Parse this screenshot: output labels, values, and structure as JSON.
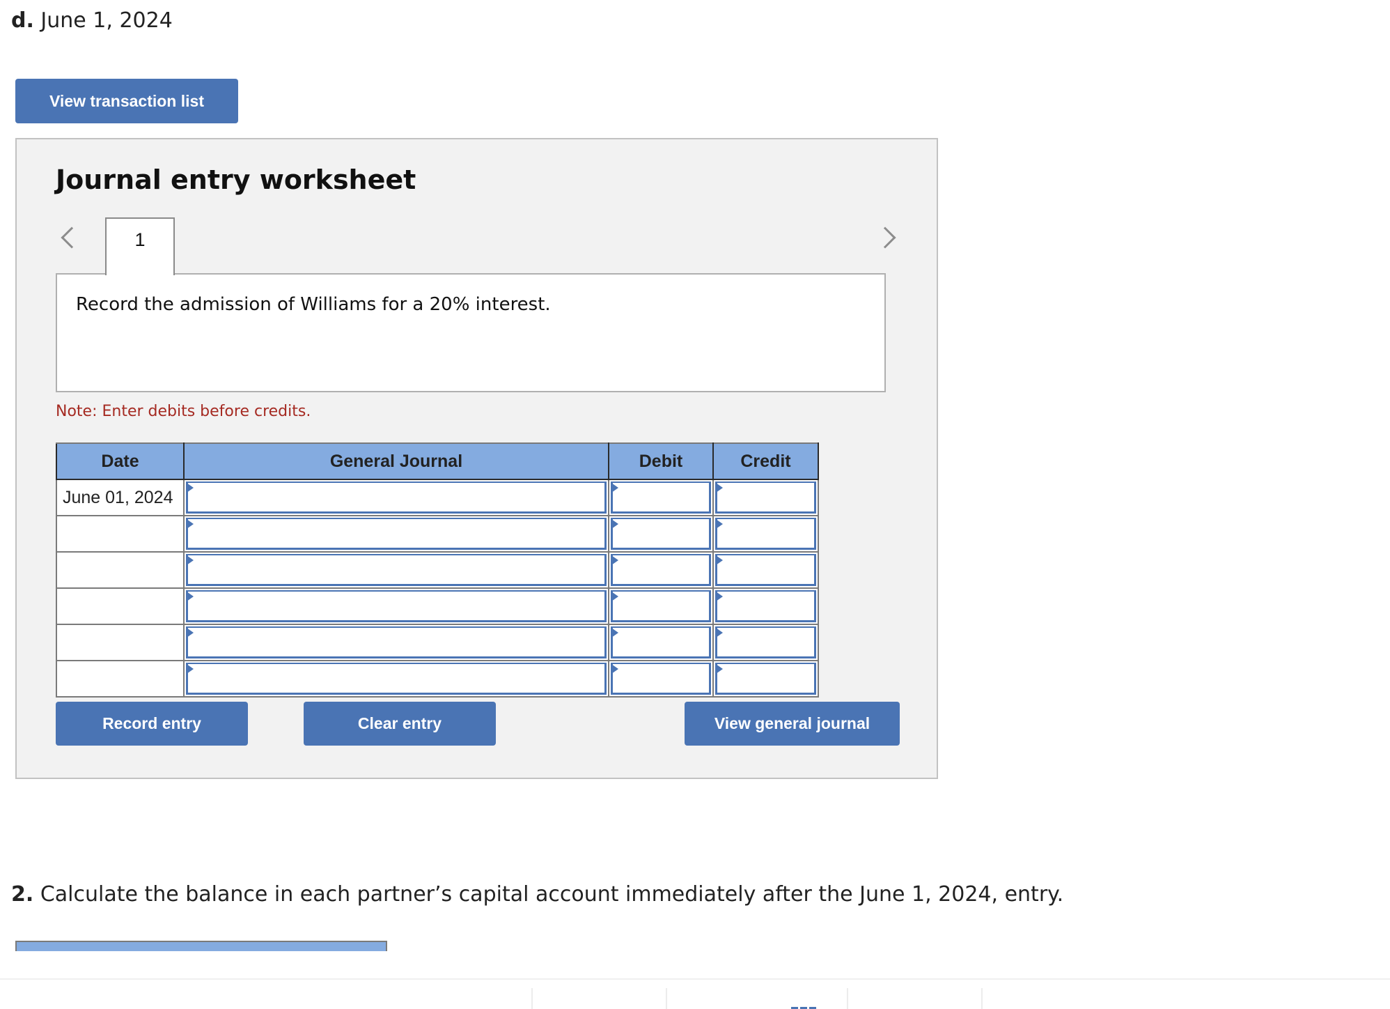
{
  "part": {
    "label": "d.",
    "date": "June 1, 2024"
  },
  "buttons": {
    "view_transaction_list": "View transaction list",
    "record_entry": "Record entry",
    "clear_entry": "Clear entry",
    "view_general_journal": "View general journal"
  },
  "worksheet": {
    "title": "Journal entry worksheet",
    "tabs": [
      {
        "label": "1",
        "active": true
      }
    ],
    "description": "Record the admission of Williams for a 20% interest.",
    "note": "Note: Enter debits before credits.",
    "table": {
      "headers": [
        "Date",
        "General Journal",
        "Debit",
        "Credit"
      ],
      "rows": [
        {
          "date": "June 01, 2024",
          "account": "",
          "debit": "",
          "credit": ""
        },
        {
          "date": "",
          "account": "",
          "debit": "",
          "credit": ""
        },
        {
          "date": "",
          "account": "",
          "debit": "",
          "credit": ""
        },
        {
          "date": "",
          "account": "",
          "debit": "",
          "credit": ""
        },
        {
          "date": "",
          "account": "",
          "debit": "",
          "credit": ""
        },
        {
          "date": "",
          "account": "",
          "debit": "",
          "credit": ""
        }
      ]
    }
  },
  "question2": {
    "number": "2.",
    "text": "Calculate the balance in each partner’s capital account immediately after the June 1, 2024, entry."
  },
  "colors": {
    "accent": "#4a74b4",
    "header_blue": "#84abe0",
    "panel_bg": "#f2f2f2",
    "note_red": "#a52a22"
  },
  "icons": {
    "prev": "chevron-left-icon",
    "next": "chevron-right-icon",
    "footer": "grid-icon"
  }
}
